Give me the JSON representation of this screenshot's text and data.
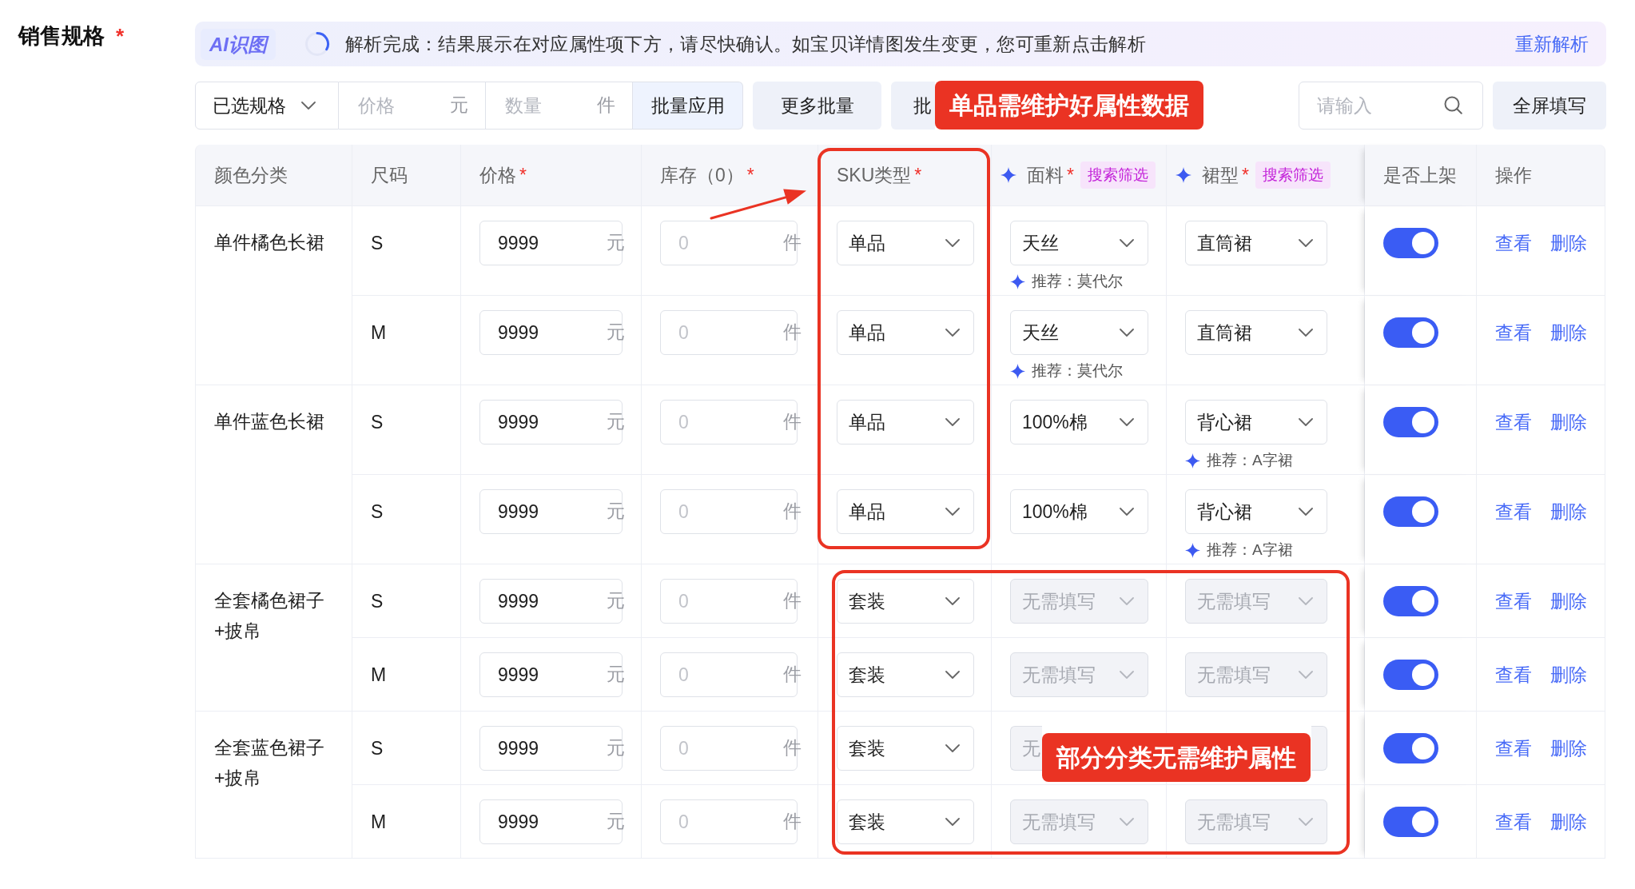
{
  "section": {
    "title": "销售规格",
    "required_mark": "*"
  },
  "ai_banner": {
    "badge": "AI识图",
    "message": "解析完成：结果展示在对应属性项下方，请尽快确认。如宝贝详情图发生变更，您可重新点击解析",
    "action": "重新解析"
  },
  "toolbar": {
    "spec_select": "已选规格",
    "price": {
      "placeholder": "价格",
      "unit": "元"
    },
    "quantity": {
      "placeholder": "数量",
      "unit": "件"
    },
    "apply": "批量应用",
    "buttons": [
      {
        "kind": "more",
        "label": "更多批量"
      },
      {
        "kind": "batch",
        "label": "批"
      }
    ],
    "search": {
      "placeholder": "请输入"
    },
    "fullscreen": "全屏填写"
  },
  "table": {
    "columns": [
      {
        "label": "颜色分类",
        "ai": false
      },
      {
        "label": "尺码",
        "ai": false
      },
      {
        "label": "价格",
        "required_mark": "*",
        "ai": false
      },
      {
        "label": "库存（0）",
        "required_mark": "*",
        "ai": false
      },
      {
        "label": "SKU类型",
        "required_mark": "*",
        "ai": false
      },
      {
        "label": "面料",
        "required_mark": "*",
        "ai": true,
        "tag": "搜索筛选"
      },
      {
        "label": "裙型",
        "required_mark": "*",
        "ai": true,
        "tag": "搜索筛选"
      },
      {
        "label": "是否上架",
        "ai": false
      },
      {
        "label": "操作",
        "ai": false
      }
    ],
    "groups": [
      {
        "name": "单件橘色长裙",
        "variants": [
          {
            "size": "S",
            "price": {
              "value": "9999",
              "unit": "元"
            },
            "stock": {
              "placeholder": "0",
              "unit": "件"
            },
            "sku_type": {
              "value": "单品",
              "disabled": false,
              "caret": true
            },
            "fabric": {
              "value": "天丝",
              "disabled": false,
              "caret": true,
              "hint": "推荐：莫代尔"
            },
            "style": {
              "value": "直筒裙",
              "disabled": false,
              "caret": true
            },
            "listed": true,
            "actions": [
              "查看",
              "删除"
            ]
          },
          {
            "size": "M",
            "price": {
              "value": "9999",
              "unit": "元"
            },
            "stock": {
              "placeholder": "0",
              "unit": "件"
            },
            "sku_type": {
              "value": "单品",
              "disabled": false,
              "caret": true
            },
            "fabric": {
              "value": "天丝",
              "disabled": false,
              "caret": true,
              "hint": "推荐：莫代尔"
            },
            "style": {
              "value": "直筒裙",
              "disabled": false,
              "caret": true
            },
            "listed": true,
            "actions": [
              "查看",
              "删除"
            ]
          }
        ]
      },
      {
        "name": "单件蓝色长裙",
        "variants": [
          {
            "size": "S",
            "price": {
              "value": "9999",
              "unit": "元"
            },
            "stock": {
              "placeholder": "0",
              "unit": "件"
            },
            "sku_type": {
              "value": "单品",
              "disabled": false,
              "caret": true
            },
            "fabric": {
              "value": "100%棉",
              "disabled": false,
              "caret": true
            },
            "style": {
              "value": "背心裙",
              "disabled": false,
              "caret": true,
              "hint": "推荐：A字裙"
            },
            "listed": true,
            "actions": [
              "查看",
              "删除"
            ]
          },
          {
            "size": "S",
            "price": {
              "value": "9999",
              "unit": "元"
            },
            "stock": {
              "placeholder": "0",
              "unit": "件"
            },
            "sku_type": {
              "value": "单品",
              "disabled": false,
              "caret": true
            },
            "fabric": {
              "value": "100%棉",
              "disabled": false,
              "caret": true
            },
            "style": {
              "value": "背心裙",
              "disabled": false,
              "caret": true,
              "hint": "推荐：A字裙"
            },
            "listed": true,
            "actions": [
              "查看",
              "删除"
            ]
          }
        ]
      },
      {
        "name": "全套橘色裙子+披帛",
        "variants": [
          {
            "size": "S",
            "price": {
              "value": "9999",
              "unit": "元"
            },
            "stock": {
              "placeholder": "0",
              "unit": "件"
            },
            "sku_type": {
              "value": "套装",
              "disabled": false,
              "caret": true
            },
            "fabric": {
              "placeholder": "无需填写",
              "disabled": true,
              "caret": true
            },
            "style": {
              "placeholder": "无需填写",
              "disabled": true,
              "caret": true
            },
            "listed": true,
            "actions": [
              "查看",
              "删除"
            ]
          },
          {
            "size": "M",
            "price": {
              "value": "9999",
              "unit": "元"
            },
            "stock": {
              "placeholder": "0",
              "unit": "件"
            },
            "sku_type": {
              "value": "套装",
              "disabled": false,
              "caret": true
            },
            "fabric": {
              "placeholder": "无需填写",
              "disabled": true,
              "caret": true
            },
            "style": {
              "placeholder": "无需填写",
              "disabled": true,
              "caret": true
            },
            "listed": true,
            "actions": [
              "查看",
              "删除"
            ]
          }
        ]
      },
      {
        "name": "全套蓝色裙子+披帛",
        "variants": [
          {
            "size": "S",
            "price": {
              "value": "9999",
              "unit": "元"
            },
            "stock": {
              "placeholder": "0",
              "unit": "件"
            },
            "sku_type": {
              "value": "套装",
              "disabled": false,
              "caret": true
            },
            "fabric": {
              "placeholder": "无",
              "disabled": true,
              "caret": false
            },
            "style": {
              "disabled": true,
              "caret": false
            },
            "listed": true,
            "actions": [
              "查看",
              "删除"
            ]
          },
          {
            "size": "M",
            "price": {
              "value": "9999",
              "unit": "元"
            },
            "stock": {
              "placeholder": "0",
              "unit": "件"
            },
            "sku_type": {
              "value": "套装",
              "disabled": false,
              "caret": true
            },
            "fabric": {
              "placeholder": "无需填写",
              "disabled": true,
              "caret": true
            },
            "style": {
              "placeholder": "无需填写",
              "disabled": true,
              "caret": true
            },
            "listed": true,
            "actions": [
              "查看",
              "删除"
            ]
          }
        ]
      }
    ]
  },
  "annotations": [
    {
      "kind": "frame"
    },
    {
      "kind": "arrow"
    },
    {
      "kind": "callout",
      "text": "单品需维护好属性数据"
    },
    {
      "kind": "frame"
    },
    {
      "kind": "callout",
      "text": "部分分类无需维护属性"
    }
  ]
}
